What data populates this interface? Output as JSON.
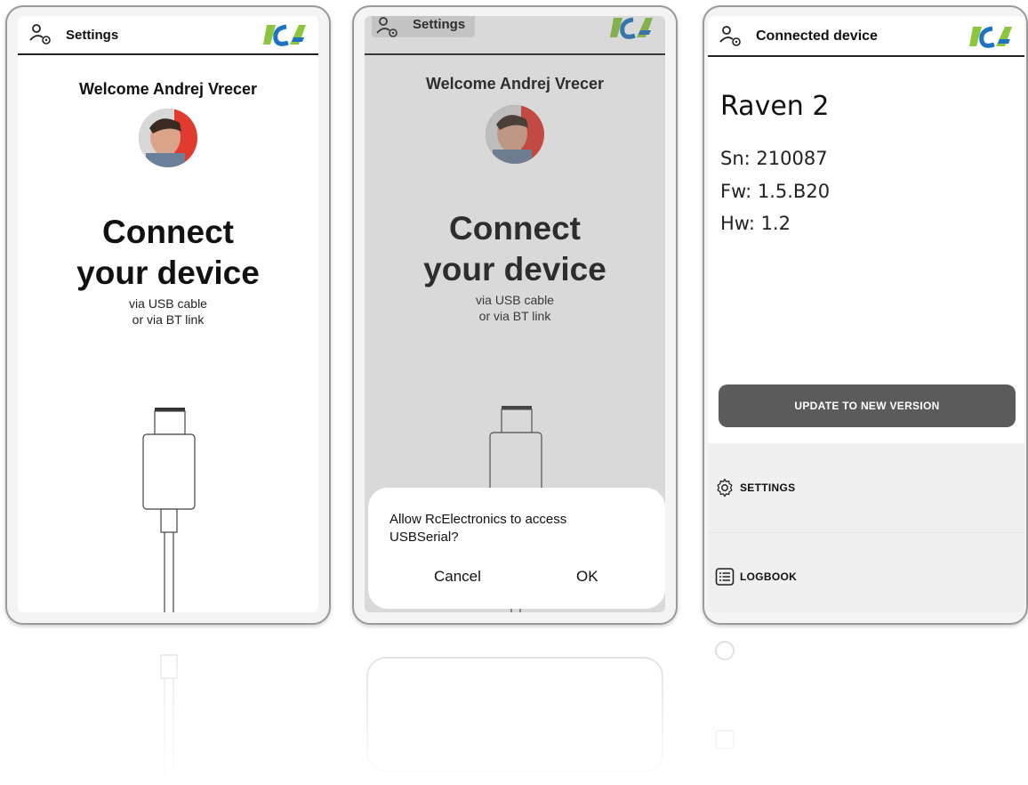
{
  "screen1": {
    "title": "Settings",
    "welcome": "Welcome Andrej Vrecer",
    "connect_line1": "Connect",
    "connect_line2": "your device",
    "sub_line1": "via USB cable",
    "sub_line2": "or via BT link"
  },
  "screen2": {
    "title": "Settings",
    "welcome": "Welcome Andrej Vrecer",
    "connect_line1": "Connect",
    "connect_line2": "your device",
    "sub_line1": "via USB cable",
    "sub_line2": "or via BT link",
    "dialog": {
      "message": "Allow RcElectronics to access USBSerial?",
      "cancel": "Cancel",
      "ok": "OK"
    }
  },
  "screen3": {
    "title": "Connected device",
    "device_name": "Raven 2",
    "serial": "Sn: 210087",
    "firmware": "Fw: 1.5.B20",
    "hardware": "Hw: 1.2",
    "update_button": "UPDATE TO NEW VERSION",
    "menu": [
      {
        "label": "SETTINGS",
        "icon": "gear-icon"
      },
      {
        "label": "LOGBOOK",
        "icon": "list-icon"
      }
    ]
  },
  "colors": {
    "logo_green": "#8cc63f",
    "logo_blue": "#1e73be",
    "button_gray": "#5b5b5b",
    "menu_bg": "#f0f0f0"
  }
}
